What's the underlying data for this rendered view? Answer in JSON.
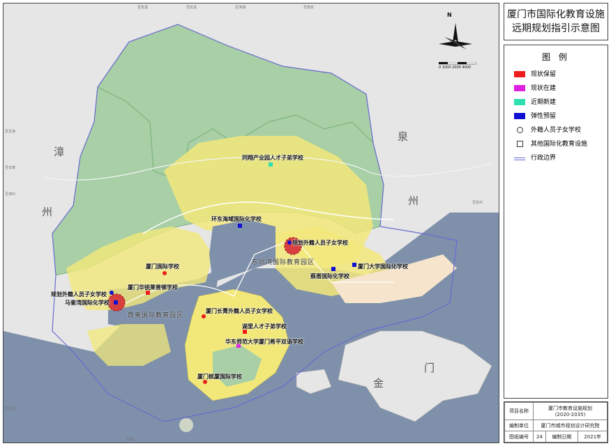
{
  "title": {
    "line1": "厦门市国际化教育设施",
    "line2": "远期规划指引示意图"
  },
  "legend": {
    "title": "图 例",
    "items": [
      {
        "label": "现状保留",
        "color": "#ee1c1c",
        "kind": "fill"
      },
      {
        "label": "现状在建",
        "color": "#e020e0",
        "kind": "fill"
      },
      {
        "label": "近期新建",
        "color": "#2ee0b0",
        "kind": "fill"
      },
      {
        "label": "弹性预留",
        "color": "#1010d0",
        "kind": "fill"
      },
      {
        "label": "外籍人员子女学校",
        "color": "#333333",
        "kind": "circle"
      },
      {
        "label": "其他国际化教育设施",
        "color": "#333333",
        "kind": "square"
      },
      {
        "label": "行政边界",
        "color": "#6a6ad0",
        "kind": "line"
      }
    ]
  },
  "info": {
    "project_label": "项目名称",
    "project_value1": "厦门市教育设施规划",
    "project_value2": "(2020-2035)",
    "org_label": "编制单位",
    "org_value": "厦门市城市规划设计研究院",
    "num_label": "图纸编号",
    "num_value": "24",
    "date_label": "编制日期",
    "date_value": "2021年"
  },
  "map": {
    "north": "N",
    "scale": "0  1000 2000  4000",
    "regions": {
      "zhang": "漳",
      "zhou_left": "州",
      "quan": "泉",
      "zhou_right": "州",
      "jin": "金",
      "men": "门"
    },
    "zones": {
      "dongjie": "东坑湾国际教育园区",
      "dingmei": "鼎美国际教育园区"
    },
    "schools": [
      {
        "name": "同翔产业园人才子弟学校",
        "color": "#2ee0b0"
      },
      {
        "name": "环东海域国际化学校",
        "color": "#1010d0"
      },
      {
        "name": "规划外籍人员子女学校",
        "color": "#1010d0"
      },
      {
        "name": "厦门大学国际化学校",
        "color": "#1010d0"
      },
      {
        "name": "蔡厝国际化学校",
        "color": "#1010d0"
      },
      {
        "name": "厦门国际学校",
        "color": "#ee1c1c"
      },
      {
        "name": "厦门华锐莱普顿学校",
        "color": "#ee1c1c"
      },
      {
        "name": "规划外籍人员子女学校",
        "color": "#1010d0"
      },
      {
        "name": "马銮湾国际化学校",
        "color": "#1010d0"
      },
      {
        "name": "厦门长菁外籍人员子女学校",
        "color": "#ee1c1c"
      },
      {
        "name": "湖里人才子弟学校",
        "color": "#ee1c1c"
      },
      {
        "name": "华东师范大学厦门希平双语学校",
        "color": "#e020e0"
      },
      {
        "name": "厦门槟厦国际学校",
        "color": "#ee1c1c"
      }
    ],
    "places": [
      "至安溪",
      "至安溪",
      "至漳浦",
      "至南安",
      "至泉州",
      "至龙海",
      "至长泰",
      "至漳州",
      "至龙海",
      "至金门"
    ]
  }
}
